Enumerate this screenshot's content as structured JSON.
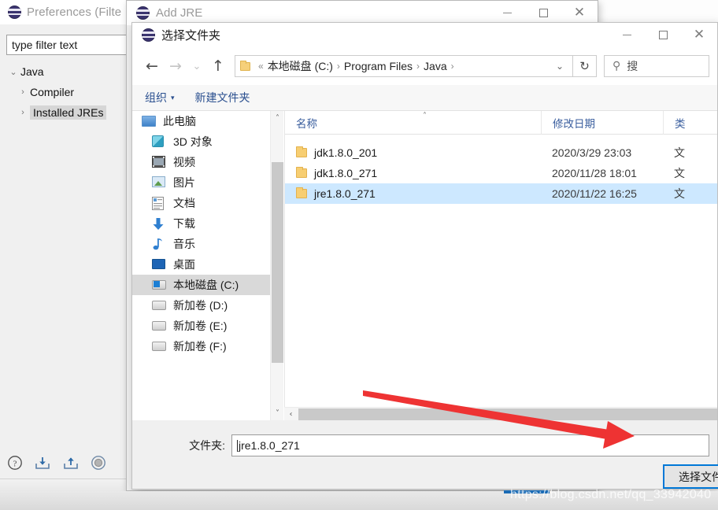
{
  "eclipse": {
    "window_title": "Preferences (Filte",
    "icon": "eclipse-globe-icon",
    "filter": {
      "value": "type filter text",
      "placeholder": "type filter text"
    },
    "tree": [
      {
        "label": "Java",
        "expander": "⌄",
        "level": 0,
        "selected": false
      },
      {
        "label": "Compiler",
        "expander": "›",
        "level": 1,
        "selected": false
      },
      {
        "label": "Installed JREs",
        "expander": "›",
        "level": 1,
        "selected": true
      }
    ],
    "footer_icons": [
      "help-icon",
      "import-icon",
      "export-icon",
      "restore-defaults-icon"
    ]
  },
  "add_jre": {
    "window_title": "Add JRE",
    "icon": "eclipse-globe-icon",
    "controls": {
      "minimize": "—",
      "maximize": "□",
      "close": "✕"
    }
  },
  "folder_dialog": {
    "title": "选择文件夹",
    "icon": "eclipse-globe-icon",
    "controls": {
      "minimize": "—",
      "maximize": "□",
      "close": "✕"
    },
    "nav": {
      "back": "←",
      "forward": "→",
      "recent": "⌄",
      "up": "↑",
      "refresh": "↻",
      "dropdown": "⌄"
    },
    "breadcrumb": {
      "prefix": "«",
      "items": [
        "本地磁盘 (C:)",
        "Program Files",
        "Java"
      ],
      "separator": "›",
      "trailing_separator": "›"
    },
    "search": {
      "icon": "search-icon",
      "placeholder": "搜"
    },
    "commands": {
      "organize": "组织",
      "organize_caret": "▾",
      "new_folder": "新建文件夹"
    },
    "sidebar": [
      {
        "label": "此电脑",
        "icon": "this-pc-icon",
        "selected": false,
        "root": true
      },
      {
        "label": "3D 对象",
        "icon": "3d-objects-icon",
        "selected": false
      },
      {
        "label": "视频",
        "icon": "videos-icon",
        "selected": false
      },
      {
        "label": "图片",
        "icon": "pictures-icon",
        "selected": false
      },
      {
        "label": "文档",
        "icon": "documents-icon",
        "selected": false
      },
      {
        "label": "下载",
        "icon": "downloads-icon",
        "selected": false
      },
      {
        "label": "音乐",
        "icon": "music-icon",
        "selected": false
      },
      {
        "label": "桌面",
        "icon": "desktop-icon",
        "selected": false
      },
      {
        "label": "本地磁盘 (C:)",
        "icon": "local-disk-icon",
        "selected": true
      },
      {
        "label": "新加卷 (D:)",
        "icon": "drive-icon",
        "selected": false
      },
      {
        "label": "新加卷 (E:)",
        "icon": "drive-icon",
        "selected": false
      },
      {
        "label": "新加卷 (F:)",
        "icon": "drive-icon",
        "selected": false
      }
    ],
    "columns": {
      "name": "名称",
      "date": "修改日期",
      "type": "类",
      "sort_indicator": "˄"
    },
    "files": [
      {
        "name": "jdk1.8.0_201",
        "date": "2020/3/29 23:03",
        "type": "文",
        "icon": "folder-icon",
        "selected": false
      },
      {
        "name": "jdk1.8.0_271",
        "date": "2020/11/28 18:01",
        "type": "文",
        "icon": "folder-icon",
        "selected": false
      },
      {
        "name": "jre1.8.0_271",
        "date": "2020/11/22 16:25",
        "type": "文",
        "icon": "folder-icon",
        "selected": true
      }
    ],
    "scrollbars": {
      "up": "˄",
      "down": "˅",
      "left": "‹"
    },
    "folder_field": {
      "label": "文件夹:",
      "value": "jre1.8.0_271"
    },
    "select_button": "选择文件夹"
  },
  "annotation": {
    "arrow_color": "#ee3333",
    "watermark": "https://blog.csdn.net/qq_33942040"
  },
  "colors": {
    "selection_blue": "#cde8ff",
    "accent_blue": "#0078d7",
    "command_link": "#2a4f8f",
    "folder_yellow": "#f7ce72"
  }
}
